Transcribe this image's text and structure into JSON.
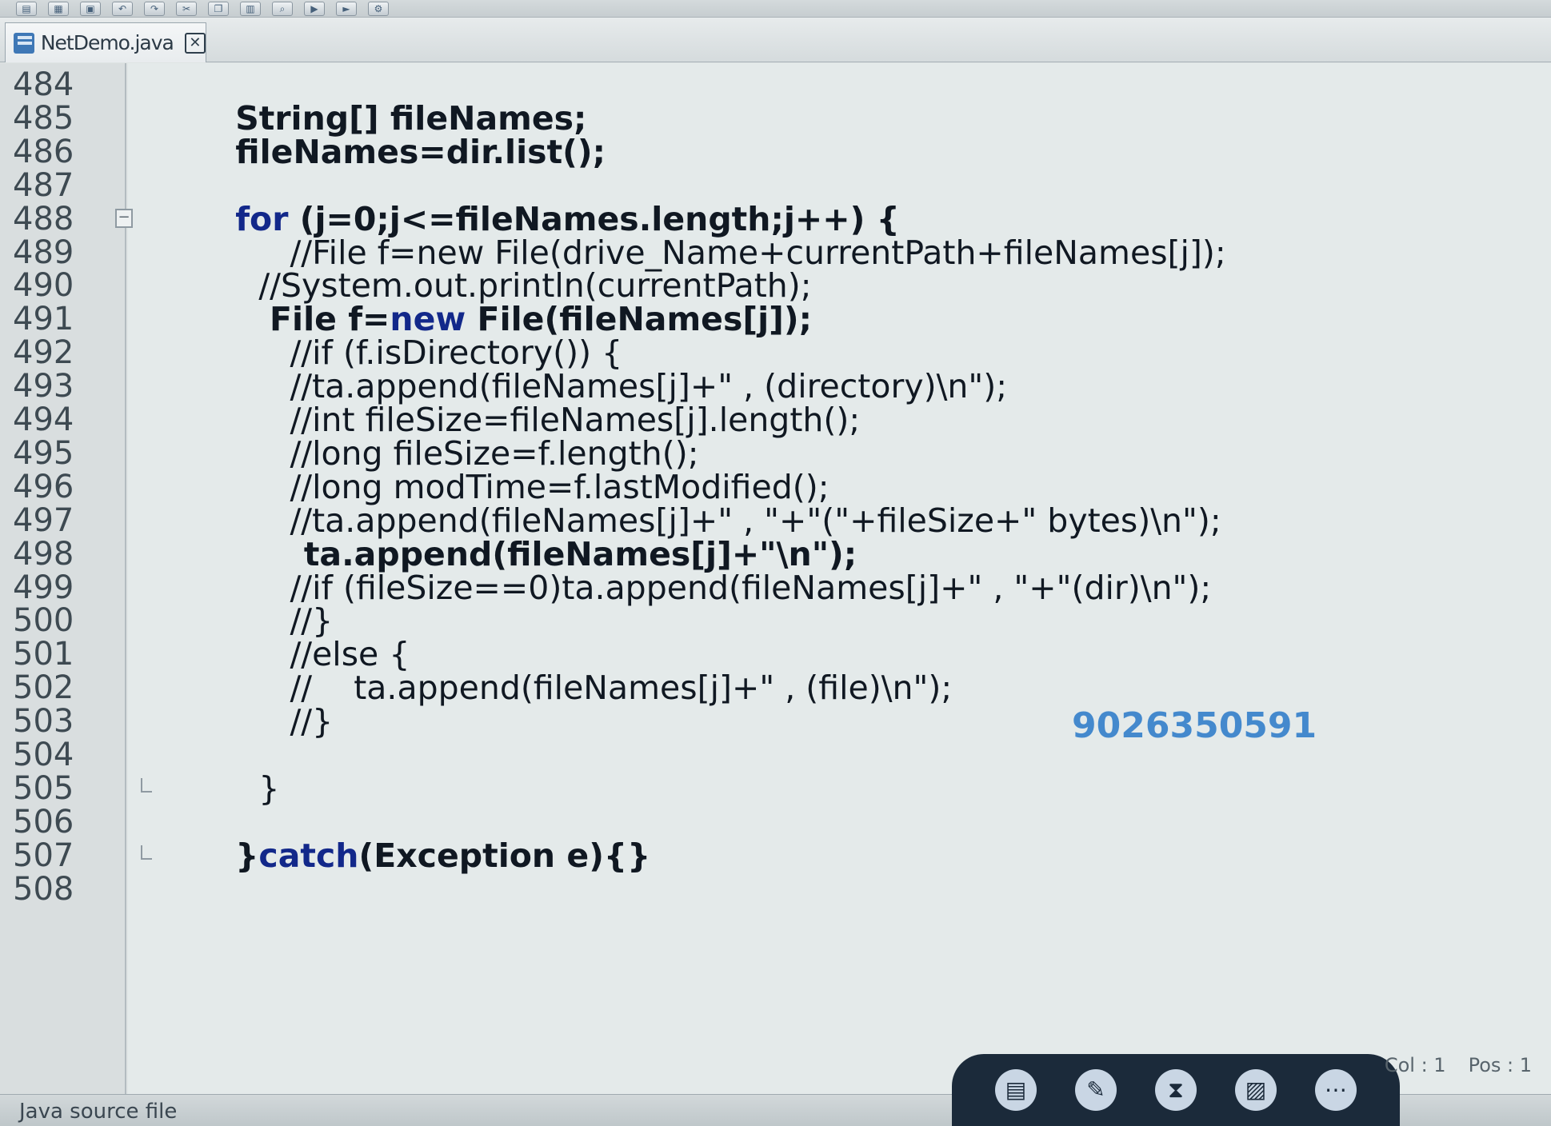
{
  "toolbar": {
    "buttons": [
      {
        "name": "toolbar-new-icon",
        "glyph": "▤"
      },
      {
        "name": "toolbar-open-icon",
        "glyph": "▦"
      },
      {
        "name": "toolbar-save-icon",
        "glyph": "▣"
      },
      {
        "name": "toolbar-undo-icon",
        "glyph": "↶"
      },
      {
        "name": "toolbar-redo-icon",
        "glyph": "↷"
      },
      {
        "name": "toolbar-cut-icon",
        "glyph": "✂"
      },
      {
        "name": "toolbar-copy-icon",
        "glyph": "❐"
      },
      {
        "name": "toolbar-paste-icon",
        "glyph": "▥"
      },
      {
        "name": "toolbar-find-icon",
        "glyph": "⌕"
      },
      {
        "name": "toolbar-compile-icon",
        "glyph": "▶"
      },
      {
        "name": "toolbar-run-icon",
        "glyph": "►"
      },
      {
        "name": "toolbar-debug-icon",
        "glyph": "⚙"
      }
    ]
  },
  "editor_tab": {
    "label": "NetDemo.java",
    "close_glyph": "✕"
  },
  "gutter": {
    "line_numbers": [
      "484",
      "485",
      "486",
      "487",
      "488",
      "489",
      "490",
      "491",
      "492",
      "493",
      "494",
      "495",
      "496",
      "497",
      "498",
      "499",
      "500",
      "501",
      "502",
      "503",
      "504",
      "505",
      "506",
      "507",
      "508"
    ],
    "fold_marker_glyph": "−"
  },
  "code": {
    "lines": [
      "",
      "        String[] fileNames;",
      "        fileNames=dir.list();",
      "",
      "        for (j=0;j<=fileNames.length;j++) {",
      "              //File f=new File(drive_Name+currentPath+fileNames[j]);",
      "           //System.out.println(currentPath);",
      "           File f=new File(fileNames[j]);",
      "              //if (f.isDirectory()) {",
      "              //ta.append(fileNames[j]+\" , (directory)\\n\");",
      "              //int fileSize=fileNames[j].length();",
      "              //long fileSize=f.length();",
      "              //long modTime=f.lastModified();",
      "              //ta.append(fileNames[j]+\" , \"+\"(\"+fileSize+\" bytes)\\n\");",
      "              ta.append(fileNames[j]+\"\\n\");",
      "              //if (fileSize==0)ta.append(fileNames[j]+\" , \"+\"(dir)\\n\");",
      "              //}",
      "              //else {",
      "              //    ta.append(fileNames[j]+\" , (file)\\n\");",
      "              //}",
      "",
      "           }",
      "",
      "        }catch(Exception e){}",
      ""
    ],
    "for_keyword": "for",
    "new_keyword": "new",
    "catch_keyword": "catch",
    "overlay_number": "9026350591"
  },
  "status": {
    "file_type": "Java source file",
    "col": "Col : 1",
    "pos": "Pos : 1"
  },
  "dock": {
    "icons": [
      {
        "name": "dock-app-icon",
        "glyph": "▤"
      },
      {
        "name": "dock-pen-icon",
        "glyph": "✎"
      },
      {
        "name": "dock-hourglass-icon",
        "glyph": "⧗"
      },
      {
        "name": "dock-image-icon",
        "glyph": "▨"
      },
      {
        "name": "dock-more-icon",
        "glyph": "⋯"
      }
    ]
  }
}
